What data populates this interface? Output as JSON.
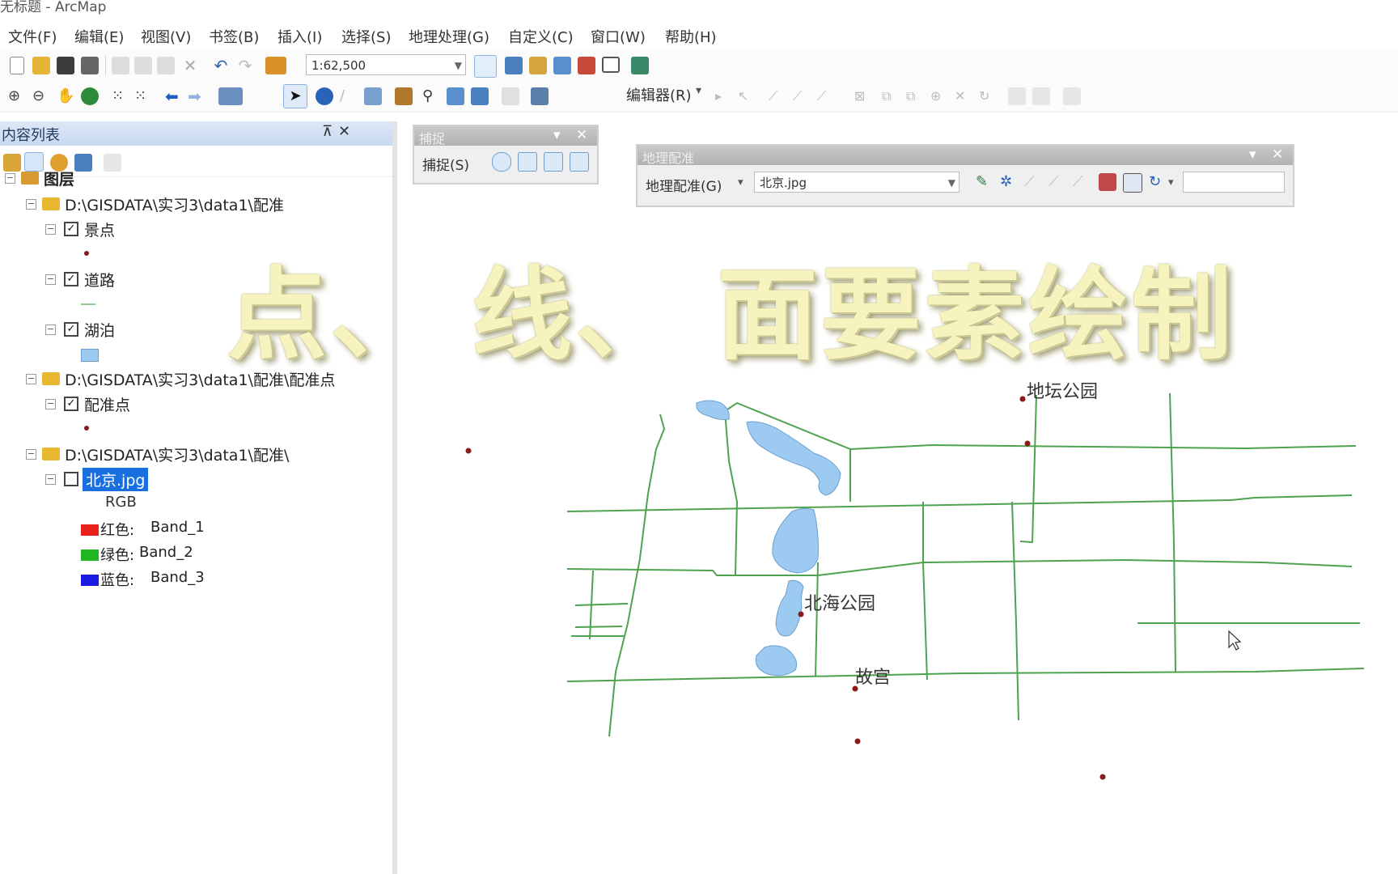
{
  "app": {
    "title": "无标题 - ArcMap"
  },
  "menu": [
    "文件(F)",
    "编辑(E)",
    "视图(V)",
    "书签(B)",
    "插入(I)",
    "选择(S)",
    "地理处理(G)",
    "自定义(C)",
    "窗口(W)",
    "帮助(H)"
  ],
  "toolbar": {
    "scale_value": "1:62,500",
    "editor_label": "编辑器(R)"
  },
  "toc": {
    "title": "内容列表",
    "root": "图层",
    "groups": [
      {
        "path": "D:\\GISDATA\\实习3\\data1\\配准",
        "layers": [
          "景点",
          "道路",
          "湖泊"
        ]
      },
      {
        "path": "D:\\GISDATA\\实习3\\data1\\配准\\配准点",
        "layers": [
          "配准点"
        ]
      },
      {
        "path": "D:\\GISDATA\\实习3\\data1\\配准\\",
        "raster": "北京.jpg",
        "rgb": "RGB",
        "bands": [
          {
            "color": "红色:",
            "band": "Band_1"
          },
          {
            "color": "绿色:",
            "band": "Band_2"
          },
          {
            "color": "蓝色:",
            "band": "Band_3"
          }
        ]
      }
    ]
  },
  "snapping": {
    "title": "捕捉",
    "menu": "捕捉(S)"
  },
  "georef": {
    "title": "地理配准",
    "menu": "地理配准(G)",
    "layer_value": "北京.jpg"
  },
  "overlay_title": "点、 线、 面要素绘制",
  "map_labels": {
    "park1": "地坛公园",
    "park2": "北海公园",
    "palace": "故宫"
  },
  "colors": {
    "road": "#4fa24f",
    "lake": "#9dcaf0",
    "point": "#8b1a1a",
    "selection": "#1a6fe0"
  }
}
